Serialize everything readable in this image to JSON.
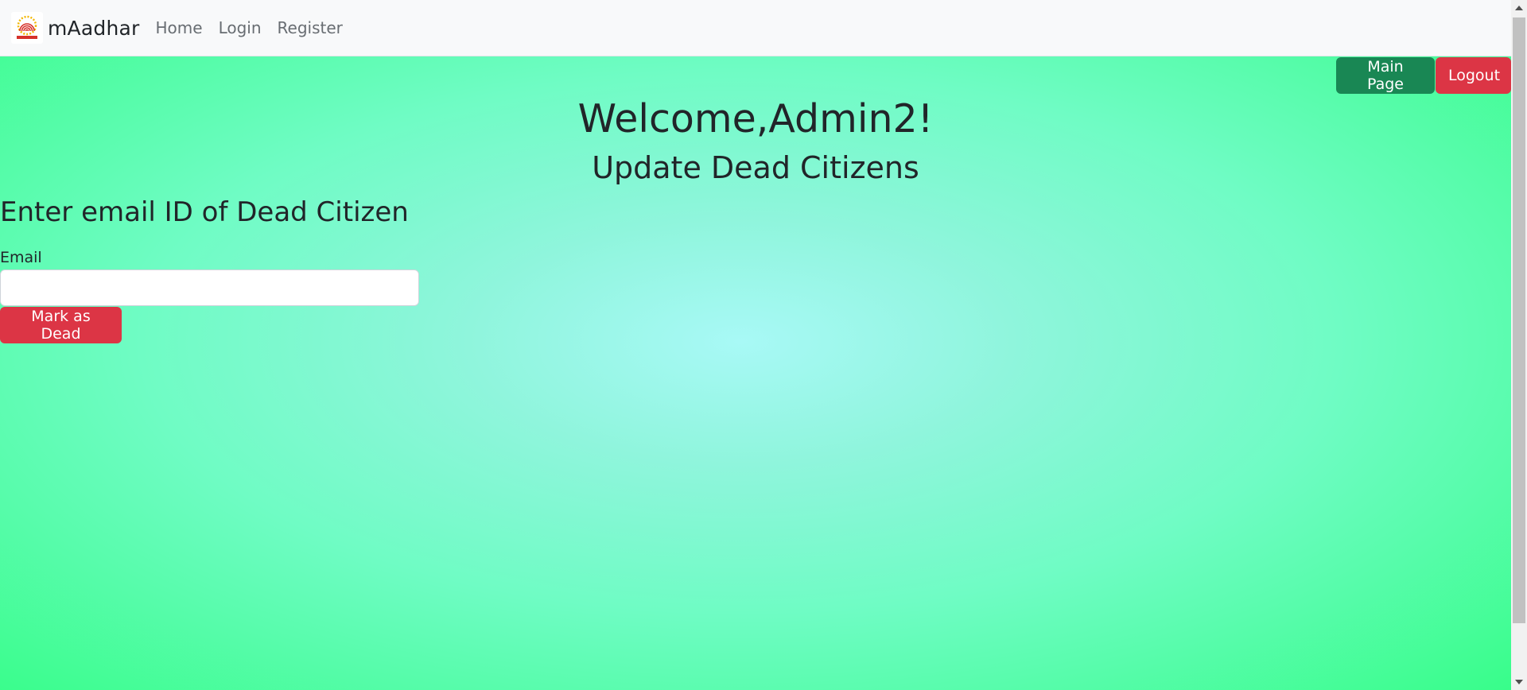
{
  "navbar": {
    "brand": "mAadhar",
    "links": [
      "Home",
      "Login",
      "Register"
    ]
  },
  "header_buttons": {
    "main_page": "Main Page",
    "logout": "Logout"
  },
  "welcome": "Welcome,Admin2!",
  "subtitle": "Update Dead Citizens",
  "form": {
    "heading": "Enter email ID of Dead Citizen",
    "email_label": "Email",
    "email_value": "",
    "submit_label": "Mark as Dead"
  },
  "colors": {
    "navbar_bg": "#f8f9fa",
    "success": "#198754",
    "danger": "#dc3545",
    "gradient_center": "#a8f9f6",
    "gradient_edge": "#38fd8a"
  },
  "icons": {
    "logo": "aadhaar-logo-icon"
  }
}
